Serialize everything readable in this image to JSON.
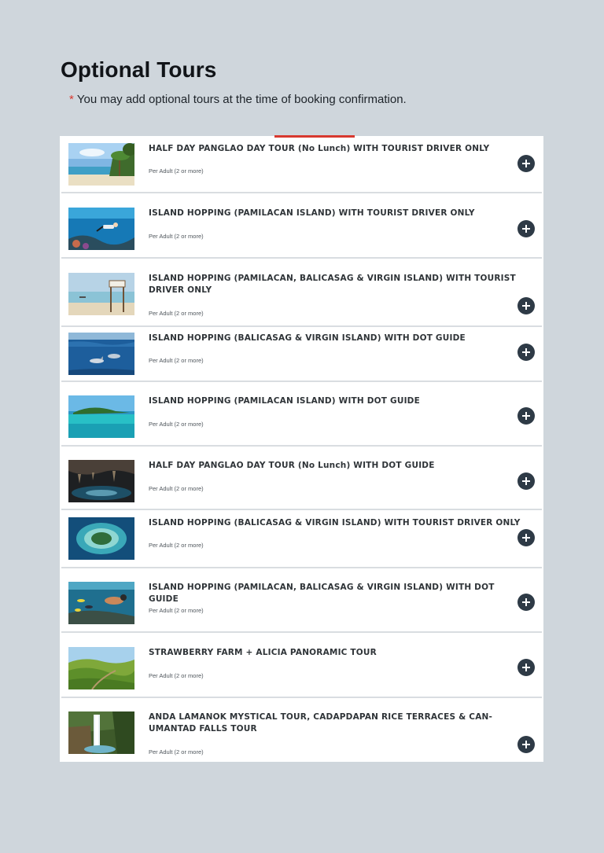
{
  "page": {
    "title": "Optional Tours",
    "note_marker": "*",
    "note_text": "You may add optional tours at the time of booking confirmation."
  },
  "colors": {
    "background": "#cfd6dc",
    "accent": "#d8392f",
    "add_button": "#2e3a46",
    "card_background": "#ffffff"
  },
  "tours": [
    {
      "name": "HALF DAY PANGLAO DAY TOUR (No Lunch) WITH TOURIST DRIVER ONLY",
      "price_label": "Per Adult (2 or more)",
      "image": "beach-palm-trees",
      "action_icon": "plus-circle-icon"
    },
    {
      "name": "ISLAND HOPPING (PAMILACAN ISLAND) WITH TOURIST DRIVER ONLY",
      "price_label": "Per Adult (2 or more)",
      "image": "snorkeler-underwater",
      "action_icon": "plus-circle-icon"
    },
    {
      "name": "ISLAND HOPPING (PAMILACAN, BALICASAG & VIRGIN ISLAND) WITH TOURIST DRIVER ONLY",
      "price_label": "Per Adult (2 or more)",
      "image": "sandbar-sign",
      "action_icon": "plus-circle-icon"
    },
    {
      "name": "ISLAND HOPPING (BALICASAG & VIRGIN ISLAND) WITH DOT GUIDE",
      "price_label": "Per Adult (2 or more)",
      "image": "dolphins-sea",
      "action_icon": "plus-circle-icon"
    },
    {
      "name": "ISLAND HOPPING (PAMILACAN ISLAND) WITH DOT GUIDE",
      "price_label": "Per Adult (2 or more)",
      "image": "island-lagoon",
      "action_icon": "plus-circle-icon"
    },
    {
      "name": "HALF DAY PANGLAO DAY TOUR (No Lunch) WITH DOT GUIDE",
      "price_label": "Per Adult (2 or more)",
      "image": "cave-pool",
      "action_icon": "plus-circle-icon"
    },
    {
      "name": "ISLAND HOPPING (BALICASAG & VIRGIN ISLAND) WITH TOURIST DRIVER ONLY",
      "price_label": "Per Adult (2 or more)",
      "image": "aerial-island-reef",
      "action_icon": "plus-circle-icon"
    },
    {
      "name": "ISLAND HOPPING (PAMILACAN, BALICASAG & VIRGIN ISLAND) WITH DOT GUIDE",
      "price_label": "Per Adult (2 or more)",
      "image": "snorkeler-with-fish",
      "action_icon": "plus-circle-icon"
    },
    {
      "name": "STRAWBERRY FARM + ALICIA PANORAMIC TOUR",
      "price_label": "Per Adult (2 or more)",
      "image": "green-hills",
      "action_icon": "plus-circle-icon"
    },
    {
      "name": "ANDA LAMANOK MYSTICAL TOUR, CADAPDAPAN RICE TERRACES & CAN-UMANTAD FALLS TOUR",
      "price_label": "Per Adult (2 or more)",
      "image": "waterfall",
      "action_icon": "plus-circle-icon"
    }
  ]
}
